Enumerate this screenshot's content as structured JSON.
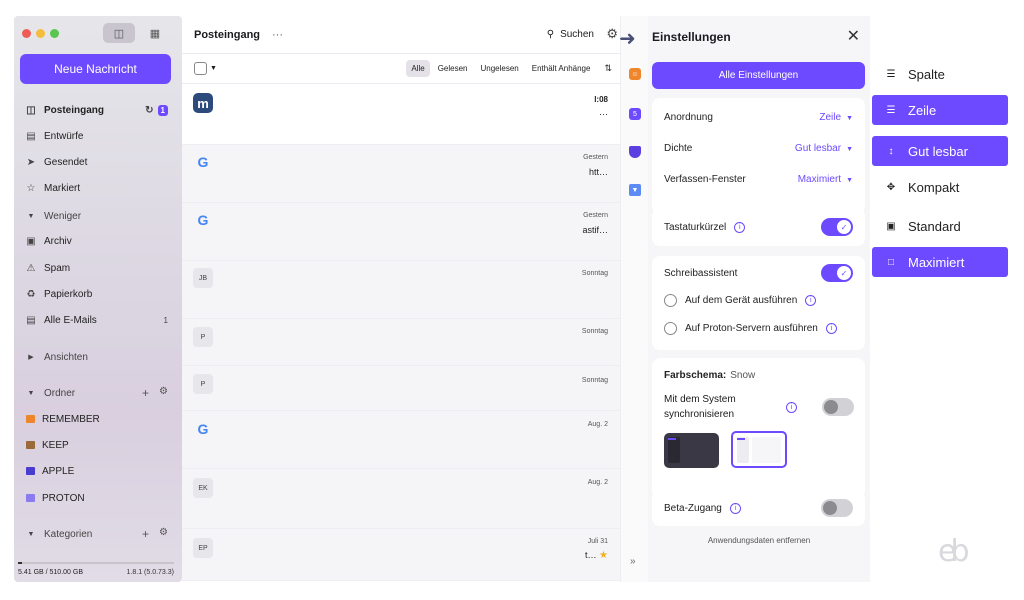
{
  "sidebar": {
    "compose_label": "Neue Nachricht",
    "items": [
      {
        "label": "Posteingang",
        "icon": "inbox-icon",
        "badge": "1"
      },
      {
        "label": "Entwürfe",
        "icon": "draft-icon"
      },
      {
        "label": "Gesendet",
        "icon": "send-icon"
      },
      {
        "label": "Markiert",
        "icon": "star-icon"
      },
      {
        "label": "Weniger",
        "icon": "chevron-down-icon"
      },
      {
        "label": "Archiv",
        "icon": "archive-icon"
      },
      {
        "label": "Spam",
        "icon": "spam-icon"
      },
      {
        "label": "Papierkorb",
        "icon": "trash-icon"
      },
      {
        "label": "Alle E-Mails",
        "icon": "all-mail-icon",
        "count": "1"
      },
      {
        "label": "Ansichten",
        "icon": "chevron-right-icon"
      },
      {
        "label": "Ordner",
        "icon": "chevron-down-icon"
      },
      {
        "label": "REMEMBER",
        "color": "#f0862c"
      },
      {
        "label": "KEEP",
        "color": "#9a6a3b"
      },
      {
        "label": "APPLE",
        "color": "#4a3bd1"
      },
      {
        "label": "PROTON",
        "color": "#8a7cf0"
      },
      {
        "label": "Kategorien",
        "icon": "chevron-down-icon"
      }
    ],
    "storage": "5.41 GB / 510.00 GB",
    "storage_used_fraction": 0.011,
    "version": "1.8.1 (5.0.73.3)"
  },
  "mail": {
    "title": "Posteingang",
    "more": "···",
    "search_label": "Suchen",
    "filters": [
      "Alle",
      "Gelesen",
      "Ungelesen",
      "Enthält Anhänge"
    ],
    "rows": [
      {
        "avatar": "m",
        "date": "l:08",
        "snippet": "···"
      },
      {
        "avatar": "G",
        "date": "Gestern",
        "snippet": "htt…"
      },
      {
        "avatar": "G",
        "date": "Gestern",
        "snippet": "astif…"
      },
      {
        "avatar": "JB",
        "date": "Sonntag",
        "snippet": ""
      },
      {
        "avatar": "P",
        "date": "Sonntag",
        "snippet": ""
      },
      {
        "avatar": "P",
        "date": "Sonntag",
        "snippet": ""
      },
      {
        "avatar": "G",
        "date": "Aug. 2",
        "snippet": ""
      },
      {
        "avatar": "EK",
        "date": "Aug. 2",
        "snippet": ""
      },
      {
        "avatar": "EP",
        "date": "Juli 31",
        "snippet": "t…"
      }
    ]
  },
  "settings": {
    "title": "Einstellungen",
    "all_settings": "Alle Einstellungen",
    "arrangement_label": "Anordnung",
    "arrangement_value": "Zeile",
    "density_label": "Dichte",
    "density_value": "Gut lesbar",
    "composer_label": "Verfassen-Fenster",
    "composer_value": "Maximiert",
    "shortcuts_label": "Tastaturkürzel",
    "assistant_label": "Schreibassistent",
    "assistant_device": "Auf dem Gerät ausführen",
    "assistant_server": "Auf Proton-Servern ausführen",
    "theme_label": "Farbschema:",
    "theme_value": "Snow",
    "sync_label_1": "Mit dem System",
    "sync_label_2": "synchronisieren",
    "beta_label": "Beta-Zugang",
    "app_data": "Anwendungsdaten entfernen"
  },
  "popup": {
    "items": [
      {
        "label": "Spalte",
        "icon": "columns-icon",
        "selected": false
      },
      {
        "label": "Zeile",
        "icon": "rows-icon",
        "selected": true
      },
      {
        "label": "Gut lesbar",
        "icon": "comfortable-icon",
        "selected": true
      },
      {
        "label": "Kompakt",
        "icon": "compact-icon",
        "selected": false
      },
      {
        "label": "Standard",
        "icon": "window-icon",
        "selected": false
      },
      {
        "label": "Maximiert",
        "icon": "maximize-icon",
        "selected": true
      }
    ]
  },
  "colors": {
    "accent": "#6d4aff"
  }
}
